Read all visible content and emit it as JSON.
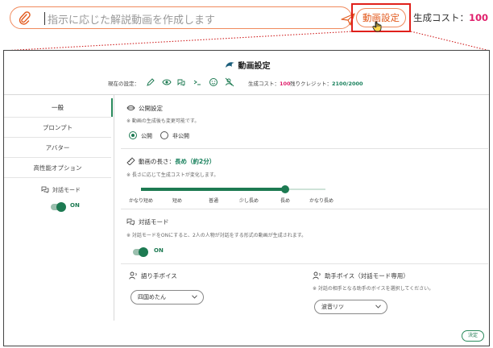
{
  "prompt_bar": {
    "placeholder": "指示に応じた解説動画を作成します",
    "video_settings_button": "動画設定",
    "cost_label": "生成コスト：",
    "cost_value": "100"
  },
  "dialog": {
    "title": "動画設定",
    "current_settings_label": "現在の設定：",
    "status_icons": [
      "pen-icon",
      "eye-icon",
      "chat-icon",
      "prompt-icon",
      "face-icon",
      "no-voice-icon"
    ],
    "cost_label": "生成コスト：",
    "cost_value": "100",
    "credit_label": "残りクレジット：",
    "credit_value": "2100/2000",
    "sidebar": {
      "items": [
        "一般",
        "プロンプト",
        "アバター",
        "高性能オプション"
      ],
      "active": "一般",
      "dialog_mode_label": "対話モード",
      "dialog_mode_toggle": "ON"
    },
    "visibility": {
      "title": "公開設定",
      "note": "※ 動画の生成後も変更可能です。",
      "options": [
        "公開",
        "非公開"
      ],
      "selected": "公開"
    },
    "length": {
      "title_prefix": "動画の長さ：",
      "title_value": "長め（約2分）",
      "note": "※ 長さに応じて生成コストが変化します。",
      "ticks": [
        "かなり短め",
        "短め",
        "普通",
        "少し長め",
        "長め",
        "かなり長め"
      ],
      "selected_index": 4
    },
    "dialog_mode": {
      "title": "対話モード",
      "note": "※ 対話モードをONにすると、2人の人物が対話をする形式の動画が生成されます。",
      "toggle": "ON"
    },
    "narrator_voice": {
      "title": "語り手ボイス",
      "selected": "四国めたん"
    },
    "assistant_voice": {
      "title": "助手ボイス（対話モード専用）",
      "note": "※ 対話の相手となる助手のボイスを選択してください。",
      "selected": "波音リツ"
    },
    "decide_button": "決定"
  },
  "colors": {
    "accent_orange": "#e25a1d",
    "highlight_red": "#e0201b",
    "cost_pink": "#e0206c",
    "primary_green": "#1d7a52"
  }
}
